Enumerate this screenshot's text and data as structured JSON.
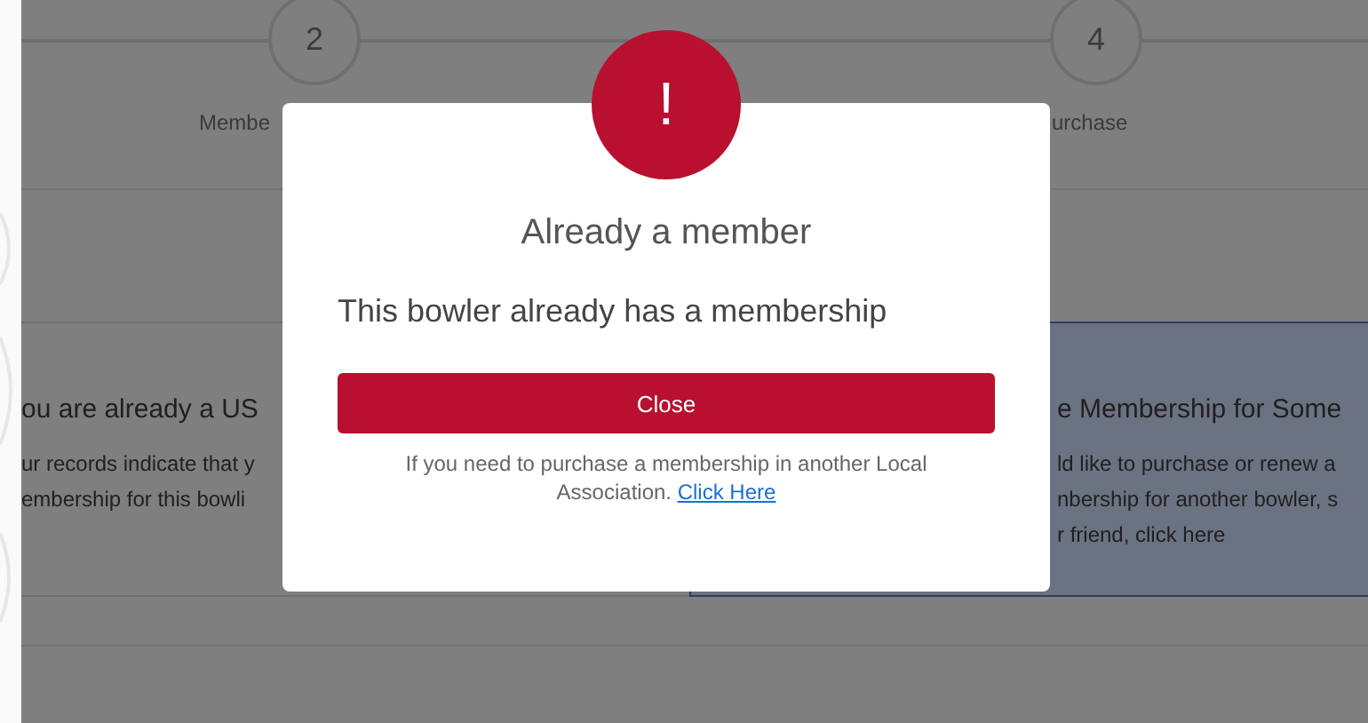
{
  "stepper": {
    "steps": [
      {
        "number": "2",
        "label": "Membe"
      },
      {
        "number": "4",
        "label": "urchase"
      }
    ]
  },
  "cards": [
    {
      "title": "ou are already a US",
      "text": [
        "ur records indicate that y",
        "embership for this bowli"
      ]
    },
    {
      "title": "e Membership for Some",
      "text": [
        "ld like to purchase or renew a",
        "nbership for another bowler, s",
        "r friend, click here"
      ]
    }
  ],
  "dialog": {
    "icon": "!",
    "title": "Already a member",
    "message": "This bowler already has a membership",
    "button": "Close",
    "note": "If you need to purchase a membership in another Local Association.",
    "link": "Click Here"
  }
}
